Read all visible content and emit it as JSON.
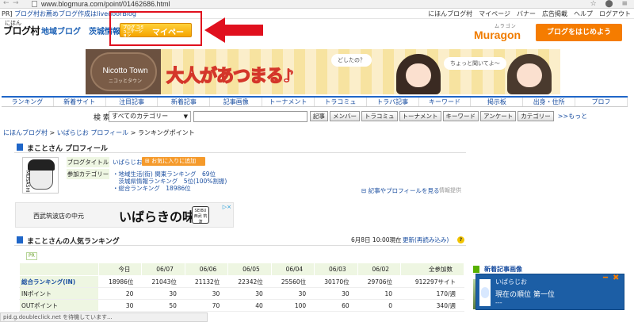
{
  "browser": {
    "url": "www.blogmura.com/point/01462686.html",
    "back_glyph": "←",
    "forward_glyph": "→",
    "icons": "☆ ⬤ ≡"
  },
  "util": {
    "pr_prefix": "PR]",
    "pr_link": "ブログ村お薦めブログ作成はlivedoorBlog",
    "links": [
      "にほんブログ村",
      "マイページ",
      "バナー",
      "広告掲載",
      "ヘルプ",
      "ログアウト"
    ]
  },
  "header": {
    "logo_small": "にほん",
    "logo": "ブログ村",
    "category_links": [
      "地域ブログ",
      "茨城情報"
    ],
    "mypage_small": "ブログ コミュニケーション",
    "mypage_label": "マイページ",
    "muragon_sub": "ムラゴン",
    "muragon": "Muragon",
    "start_blog": "ブログをはじめよう"
  },
  "banner": {
    "brand": "Nicotto Town",
    "brand_sub": "ニコッとタウン",
    "catch": "大人があつまる♪",
    "bubble1": "どしたの？",
    "bubble2": "ちょっと聞いてよ～"
  },
  "nav": {
    "items": [
      "ランキング",
      "新着サイト",
      "注目記事",
      "新着記事",
      "記事画像",
      "トーナメント",
      "トラコミュ",
      "トラバ記事",
      "キーワード",
      "掲示板",
      "出身・住所",
      "プロフ"
    ]
  },
  "search": {
    "label": "検 索",
    "select_value": "すべてのカテゴリー",
    "buttons": [
      "記事",
      "メンバー",
      "トラコミュ",
      "トーナメント",
      "キーワード",
      "アンケート",
      "カテゴリー"
    ],
    "more": ">>もっと"
  },
  "breadcrumb": {
    "home": "にほんブログ村",
    "sep": " > ",
    "profile": "いばらじお プロフィール",
    "current": "ランキングポイント"
  },
  "profile": {
    "title": "まことさん プロフィール",
    "avatar_text": "MUSASHI",
    "blog_title_label": "ブログタイトル",
    "blog_title": "いばらじお",
    "fav_button": "お気に入りに追加",
    "category_label": "参加カテゴリー",
    "categories": [
      "・地域生活(街) 関東ランキング　69位",
      "　茨城県情報ランキング　5位(100%割振)",
      "・総合ランキング　18986位"
    ],
    "see_more": "記事やプロフィールを見る",
    "info_src": "情報提供"
  },
  "ad2": {
    "left": "西武筑波店の中元",
    "main": "いばらきの味",
    "logo": "SEIBU 西武 筑波",
    "close": "▷×"
  },
  "ranking": {
    "title": "まことさんの人気ランキング",
    "date": "6月8日 10:00現在",
    "update": "更新(再読み込み)",
    "pr": "PR",
    "columns": [
      "",
      "今日",
      "06/07",
      "06/06",
      "06/05",
      "06/04",
      "06/03",
      "06/02",
      "全参加数"
    ],
    "rows": [
      {
        "label": "総合ランキング(IN)",
        "values": [
          "18986位",
          "21043位",
          "21132位",
          "22342位",
          "25560位",
          "30170位",
          "29706位",
          "912297サイト"
        ]
      },
      {
        "label": "INポイント",
        "values": [
          "20",
          "30",
          "30",
          "30",
          "30",
          "30",
          "10",
          "170/週"
        ]
      },
      {
        "label": "OUTポイント",
        "values": [
          "30",
          "50",
          "70",
          "40",
          "100",
          "60",
          "0",
          "340/週"
        ]
      }
    ]
  },
  "sidebar": {
    "new_images": "新着記事画像"
  },
  "notification": {
    "name": "いばらじお",
    "message": "現在の順位 第一位",
    "dash": "---",
    "minimize": "━",
    "close": "✖"
  },
  "status": "pid.g.doubleclick.net を待機しています...",
  "colors": {
    "accent_blue": "#1f66c8",
    "orange": "#f57c00",
    "highlight_red": "#e0101e",
    "notification_blue": "#1c5ea5"
  }
}
